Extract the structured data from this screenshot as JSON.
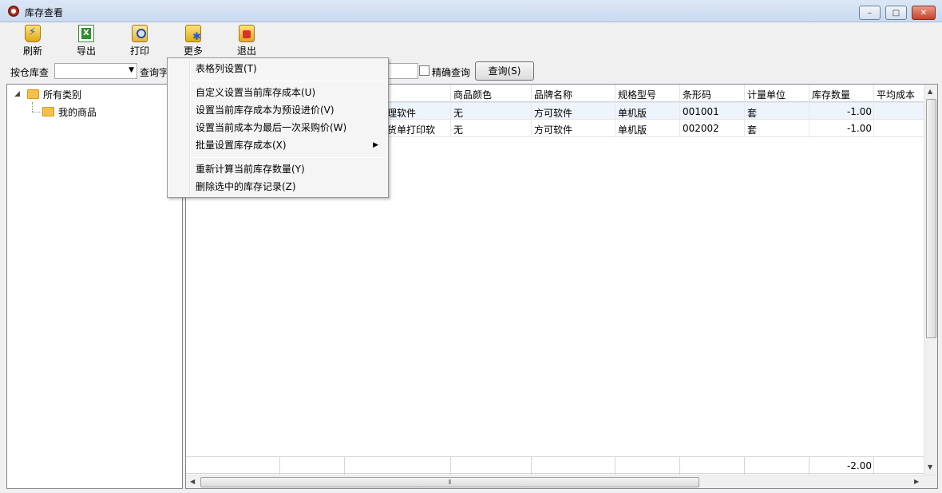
{
  "window": {
    "title": "库存查看",
    "minimize": "–",
    "maximize": "□",
    "close": "✕"
  },
  "toolbar": {
    "refresh": "刷新",
    "export": "导出",
    "print": "打印",
    "more": "更多",
    "exit": "退出"
  },
  "filter": {
    "warehouse_label": "按仓库查",
    "warehouse_value": "",
    "query_label": "查询字",
    "query_value": "",
    "exact_label": "精确查询",
    "exact_checked": false,
    "query_button": "查询(S)"
  },
  "tree": {
    "root": "所有类别",
    "child": "我的商品"
  },
  "grid": {
    "columns": [
      "商品颜色",
      "品牌名称",
      "规格型号",
      "条形码",
      "计量单位",
      "库存数量",
      "平均成本"
    ],
    "rows": [
      {
        "name": "管理软件",
        "color": "无",
        "brand": "方可软件",
        "spec": "单机版",
        "barcode": "001001",
        "unit": "套",
        "qty": "-1.00",
        "cost": ""
      },
      {
        "name": "送货单打印软",
        "color": "无",
        "brand": "方可软件",
        "spec": "单机版",
        "barcode": "002002",
        "unit": "套",
        "qty": "-1.00",
        "cost": ""
      }
    ],
    "total_qty": "-2.00"
  },
  "context_menu": {
    "items": [
      "表格列设置(T)",
      "自定义设置当前库存成本(U)",
      "设置当前库存成本为预设进价(V)",
      "设置当前成本为最后一次采购价(W)",
      "批量设置库存成本(X)",
      "重新计算当前库存数量(Y)",
      "删除选中的库存记录(Z)"
    ]
  },
  "colors": {
    "titlebar": "#c9daf0",
    "selection": "#eef4fc",
    "folder": "#f5c04a"
  }
}
